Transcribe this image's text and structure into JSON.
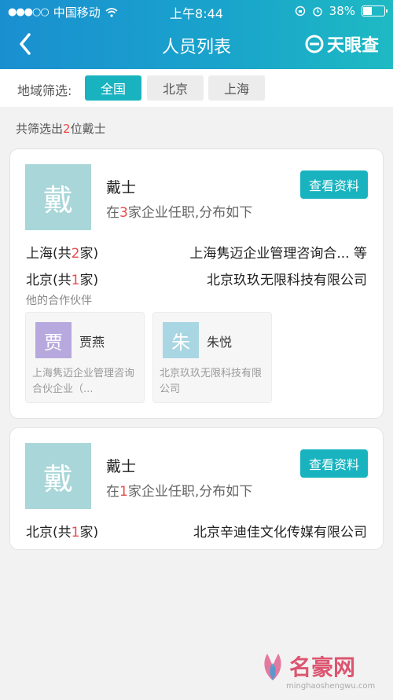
{
  "status_bar": {
    "carrier": "中国移动",
    "time": "上午8:44",
    "battery": "38%"
  },
  "nav": {
    "title": "人员列表",
    "brand": "天眼查"
  },
  "filter": {
    "label": "地域筛选:",
    "options": [
      "全国",
      "北京",
      "上海"
    ],
    "selected": "全国"
  },
  "summary": {
    "prefix": "共筛选出",
    "count": "2",
    "suffix": "位戴士"
  },
  "cards": [
    {
      "avatar_char": "戴",
      "name": "戴士",
      "sub_prefix": "在",
      "sub_count": "3",
      "sub_suffix": "家企业任职,分布如下",
      "view_label": "查看资料",
      "rows": [
        {
          "region": "上海",
          "count": "2",
          "company": "上海隽迈企业管理咨询合... 等"
        },
        {
          "region": "北京",
          "count": "1",
          "company": "北京玖玖无限科技有限公司"
        }
      ],
      "partners_title": "他的合作伙伴",
      "partners": [
        {
          "avatar_char": "贾",
          "name": "贾燕",
          "company": "上海隽迈企业管理咨询合伙企业（...",
          "color": "#b7a9dd"
        },
        {
          "avatar_char": "朱",
          "name": "朱悦",
          "company": "北京玖玖无限科技有限公司",
          "color": "#a9d6e3"
        }
      ]
    },
    {
      "avatar_char": "戴",
      "name": "戴士",
      "sub_prefix": "在",
      "sub_count": "1",
      "sub_suffix": "家企业任职,分布如下",
      "view_label": "查看资料",
      "rows": [
        {
          "region": "北京",
          "count": "1",
          "company": "北京辛迪佳文化传媒有限公司"
        }
      ]
    }
  ],
  "row_labels": {
    "open": "(共",
    "close": "家)"
  },
  "watermark": {
    "text": "名豪网",
    "url": "minghaoshengwu.com"
  },
  "colors": {
    "accent": "#19b3c0",
    "highlight": "#e84a4a",
    "header_start": "#1a8fd0",
    "header_end": "#1ebac3"
  }
}
